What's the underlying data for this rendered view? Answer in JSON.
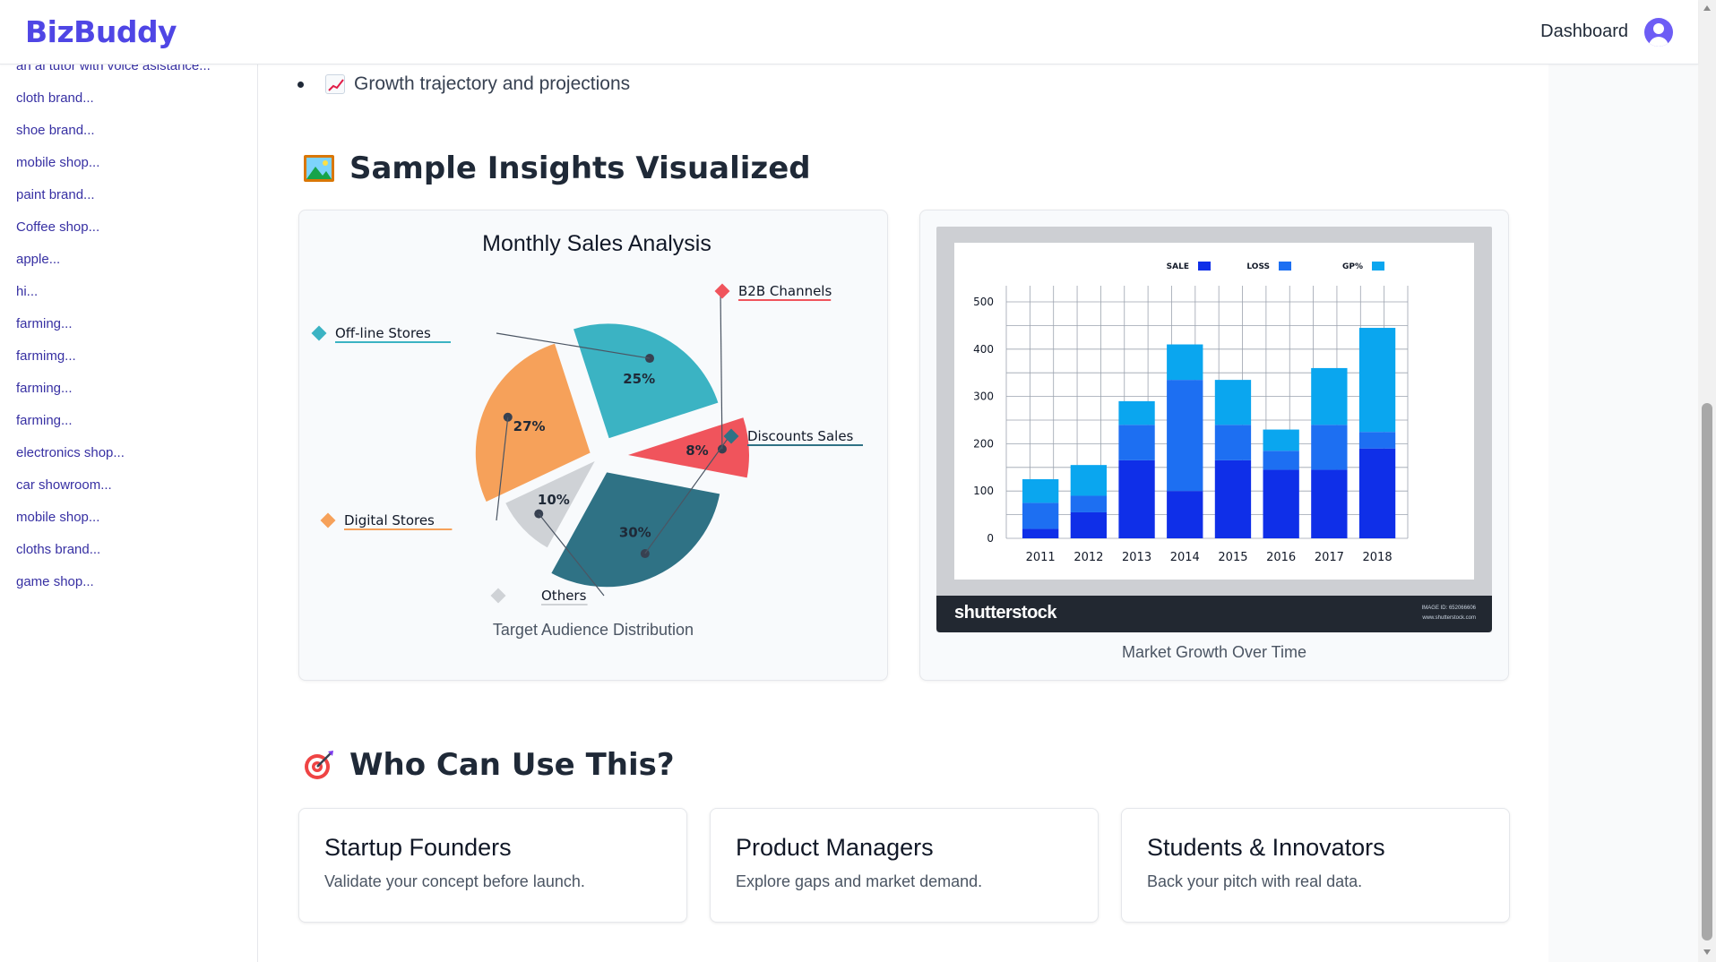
{
  "brand": "BizBuddy",
  "nav": {
    "dashboard_label": "Dashboard"
  },
  "sidebar": {
    "items": [
      "an ai tutor with voice asistance...",
      "cloth brand...",
      "shoe brand...",
      "mobile shop...",
      "paint brand...",
      "Coffee shop...",
      "apple...",
      "hi...",
      "farming...",
      "farmimg...",
      "farming...",
      "farming...",
      "electronics shop...",
      "car showroom...",
      "mobile shop...",
      "cloths brand...",
      "game shop..."
    ]
  },
  "main": {
    "bullet_text": "Growth trajectory and projections",
    "insights_title": "Sample Insights Visualized",
    "pie_card": {
      "chart_title": "Monthly Sales Analysis",
      "caption": "Target Audience Distribution"
    },
    "bar_card": {
      "caption": "Market Growth Over Time",
      "footer_brand": "shutterstock",
      "image_id_text": "IMAGE ID: 652066606",
      "site_text": "www.shutterstock.com"
    },
    "use_title": "Who Can Use This?",
    "use_cards": [
      {
        "title": "Startup Founders",
        "desc": "Validate your concept before launch."
      },
      {
        "title": "Product Managers",
        "desc": "Explore gaps and market demand."
      },
      {
        "title": "Students & Innovators",
        "desc": "Back your pitch with real data."
      }
    ]
  },
  "chart_data": [
    {
      "type": "pie",
      "title": "Monthly Sales Analysis",
      "slices": [
        {
          "label": "Off-line Stores",
          "value": 25,
          "color": "#3bb3c3"
        },
        {
          "label": "B2B Channels",
          "value": 8,
          "color": "#f0545c"
        },
        {
          "label": "Discounts Sales",
          "value": 30,
          "color": "#2f7285"
        },
        {
          "label": "Others",
          "value": 10,
          "color": "#cfd2d6"
        },
        {
          "label": "Digital Stores",
          "value": 27,
          "color": "#f6a15a"
        }
      ],
      "value_labels": [
        "25%",
        "8%",
        "30%",
        "10%",
        "27%"
      ]
    },
    {
      "type": "bar",
      "stacked": true,
      "categories": [
        "2011",
        "2012",
        "2013",
        "2014",
        "2015",
        "2016",
        "2017",
        "2018"
      ],
      "legend": [
        "SALE",
        "LOSS",
        "GP%"
      ],
      "series": [
        {
          "name": "SALE",
          "color": "#0f2fe8",
          "values": [
            20,
            55,
            165,
            100,
            165,
            145,
            145,
            190
          ]
        },
        {
          "name": "LOSS",
          "color": "#1d6ff2",
          "values": [
            55,
            35,
            75,
            235,
            75,
            40,
            95,
            35
          ]
        },
        {
          "name": "GP%",
          "color": "#0aa6ef",
          "values": [
            50,
            65,
            50,
            75,
            95,
            45,
            120,
            220
          ]
        }
      ],
      "yticks": [
        "0",
        "100",
        "200",
        "300",
        "400",
        "500"
      ],
      "ylim": [
        0,
        500
      ],
      "grid": true,
      "legend_position": "top-right"
    }
  ]
}
